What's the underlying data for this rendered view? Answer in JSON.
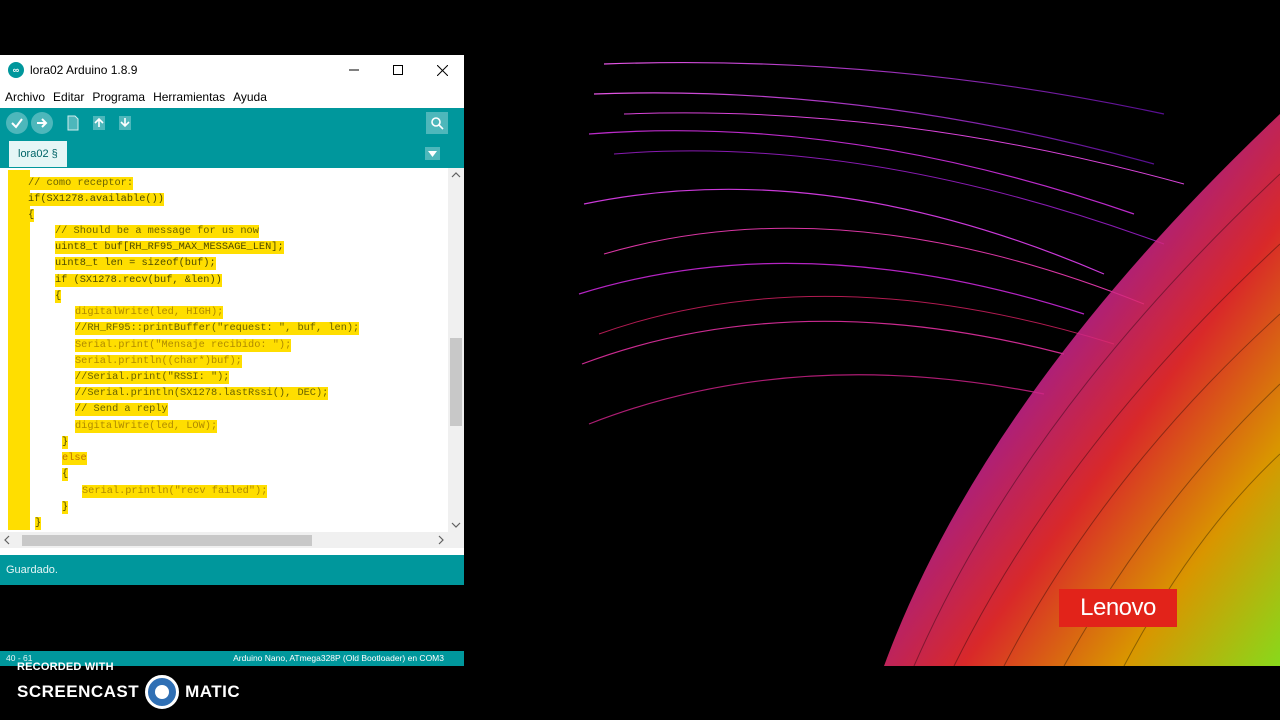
{
  "window": {
    "title": "lora02 Arduino 1.8.9",
    "menu": [
      "Archivo",
      "Editar",
      "Programa",
      "Herramientas",
      "Ayuda"
    ],
    "tab": "lora02 §"
  },
  "code_lines": [
    "// como receptor:",
    "if(SX1278.available())",
    "{",
    "// Should be a message for us now",
    "uint8_t buf[RH_RF95_MAX_MESSAGE_LEN];",
    "uint8_t len = sizeof(buf);",
    "if (SX1278.recv(buf, &len))",
    "{",
    "digitalWrite(led, HIGH);",
    "//RH_RF95::printBuffer(\"request: \", buf, len);",
    "Serial.print(\"Mensaje recibido: \");",
    "Serial.println((char*)buf);",
    "//Serial.print(\"RSSI: \");",
    "//Serial.println(SX1278.lastRssi(), DEC);",
    "// Send a reply",
    "digitalWrite(led, LOW);",
    "}",
    "else",
    "{",
    "Serial.println(\"recv failed\");",
    "}",
    "}"
  ],
  "status": {
    "message": "Guardado.",
    "line": "40 - 61",
    "board": "Arduino Nano, ATmega328P (Old Bootloader) en COM3"
  },
  "desktop": {
    "brand": "Lenovo"
  },
  "watermark": {
    "recorded": "RECORDED WITH",
    "left": "SCREENCAST",
    "right": "MATIC"
  },
  "colors": {
    "arduino_teal": "#00979c",
    "selection": "#ffde00",
    "lenovo_red": "#e2231a"
  }
}
